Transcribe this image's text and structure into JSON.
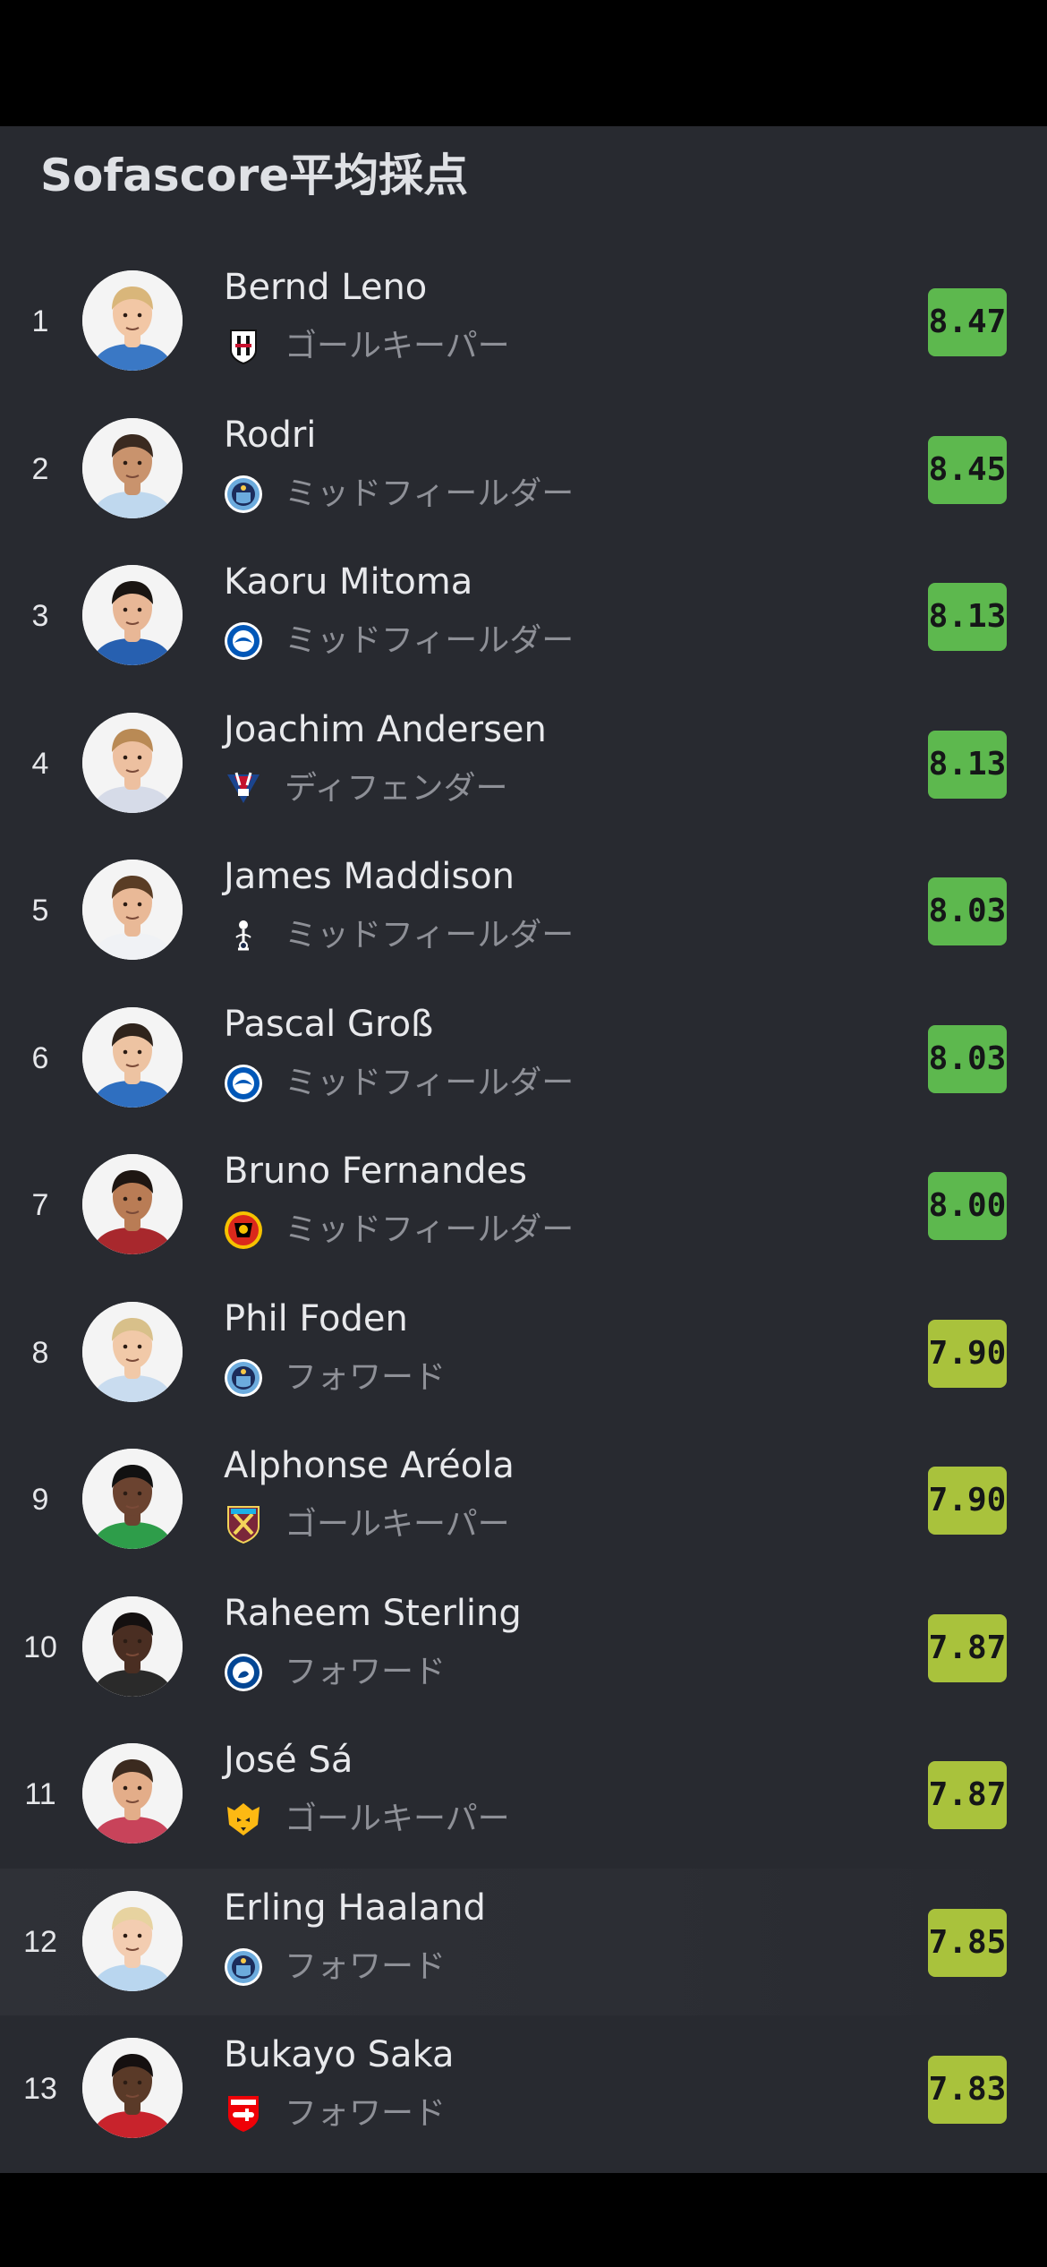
{
  "header": {
    "title": "Sofascore平均採点"
  },
  "colors": {
    "background": "#282a30",
    "rating_high": "#5db84e",
    "rating_mid": "#a9c23c"
  },
  "players": [
    {
      "rank": "1",
      "name": "Bernd Leno",
      "position": "ゴールキーパー",
      "rating": "8.47",
      "club_icon": "fulham-crest-icon"
    },
    {
      "rank": "2",
      "name": "Rodri",
      "position": "ミッドフィールダー",
      "rating": "8.45",
      "club_icon": "man-city-crest-icon"
    },
    {
      "rank": "3",
      "name": "Kaoru Mitoma",
      "position": "ミッドフィールダー",
      "rating": "8.13",
      "club_icon": "brighton-crest-icon"
    },
    {
      "rank": "4",
      "name": "Joachim Andersen",
      "position": "ディフェンダー",
      "rating": "8.13",
      "club_icon": "crystal-palace-crest-icon"
    },
    {
      "rank": "5",
      "name": "James Maddison",
      "position": "ミッドフィールダー",
      "rating": "8.03",
      "club_icon": "tottenham-crest-icon"
    },
    {
      "rank": "6",
      "name": "Pascal Groß",
      "position": "ミッドフィールダー",
      "rating": "8.03",
      "club_icon": "brighton-crest-icon"
    },
    {
      "rank": "7",
      "name": "Bruno Fernandes",
      "position": "ミッドフィールダー",
      "rating": "8.00",
      "club_icon": "man-united-crest-icon"
    },
    {
      "rank": "8",
      "name": "Phil Foden",
      "position": "フォワード",
      "rating": "7.90",
      "club_icon": "man-city-crest-icon"
    },
    {
      "rank": "9",
      "name": "Alphonse Aréola",
      "position": "ゴールキーパー",
      "rating": "7.90",
      "club_icon": "west-ham-crest-icon"
    },
    {
      "rank": "10",
      "name": "Raheem Sterling",
      "position": "フォワード",
      "rating": "7.87",
      "club_icon": "chelsea-crest-icon"
    },
    {
      "rank": "11",
      "name": "José Sá",
      "position": "ゴールキーパー",
      "rating": "7.87",
      "club_icon": "wolves-crest-icon"
    },
    {
      "rank": "12",
      "name": "Erling Haaland",
      "position": "フォワード",
      "rating": "7.85",
      "club_icon": "man-city-crest-icon"
    },
    {
      "rank": "13",
      "name": "Bukayo Saka",
      "position": "フォワード",
      "rating": "7.83",
      "club_icon": "arsenal-crest-icon"
    }
  ]
}
